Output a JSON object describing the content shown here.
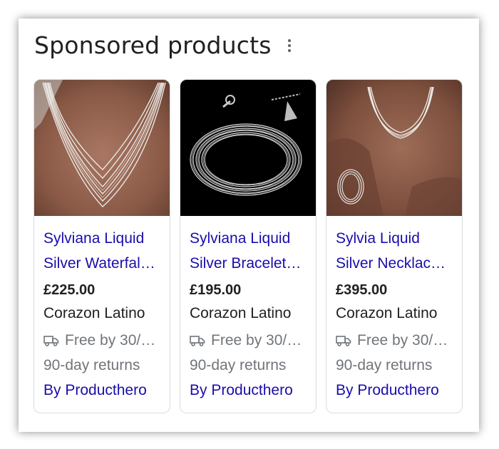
{
  "header": {
    "title": "Sponsored products",
    "more_icon": "more-vert-icon"
  },
  "colors": {
    "link": "#1a0dab",
    "text": "#202124",
    "muted": "#70757a",
    "border": "#dadce0"
  },
  "products": [
    {
      "name_line1": "Sylviana Liquid",
      "name_line2": "Silver Waterfal…",
      "price": "£225.00",
      "seller": "Corazon Latino",
      "shipping": "Free by 30/…",
      "returns": "90-day returns",
      "by": "By Producthero",
      "image": "necklace-on-model-image"
    },
    {
      "name_line1": "Sylviana Liquid",
      "name_line2": "Silver Bracelet…",
      "price": "£195.00",
      "seller": "Corazon Latino",
      "shipping": "Free by 30/…",
      "returns": "90-day returns",
      "by": "By Producthero",
      "image": "bracelet-on-black-image"
    },
    {
      "name_line1": "Sylvia Liquid",
      "name_line2": "Silver Necklac…",
      "price": "£395.00",
      "seller": "Corazon Latino",
      "shipping": "Free by 30/…",
      "returns": "90-day returns",
      "by": "By Producthero",
      "image": "choker-and-bracelet-on-model-image"
    }
  ]
}
